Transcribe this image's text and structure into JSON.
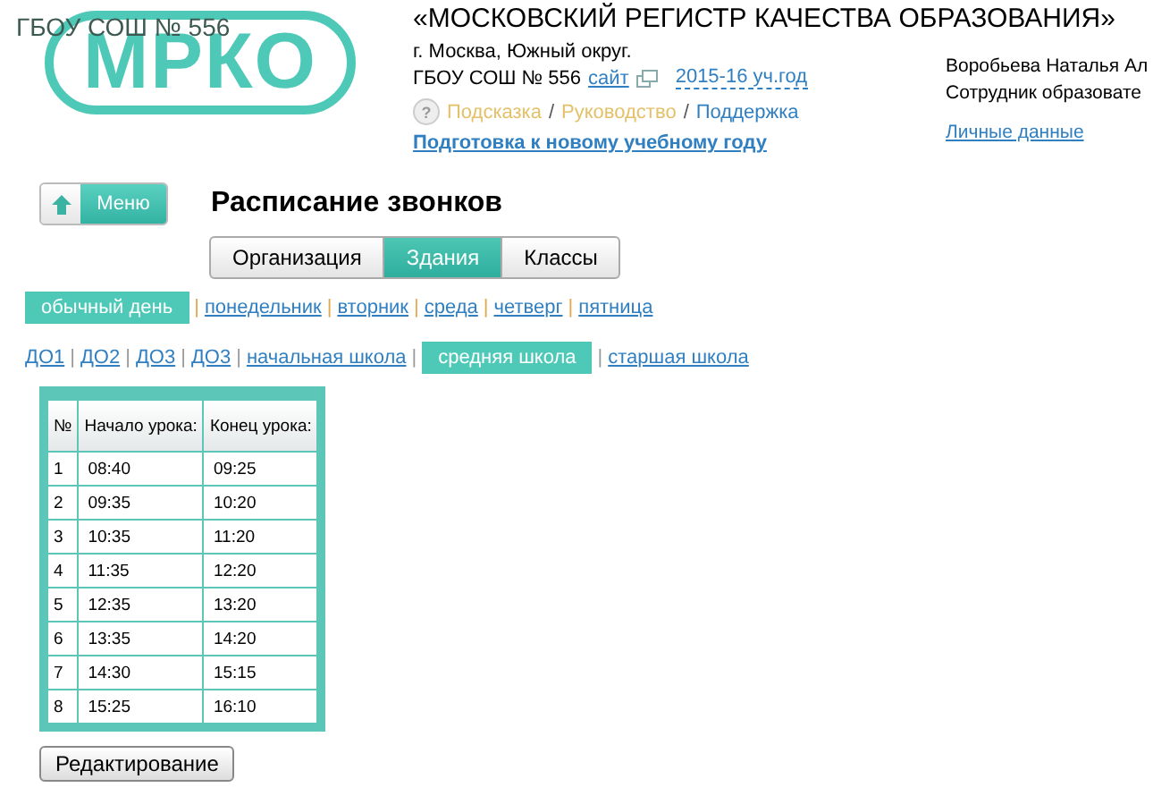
{
  "school_label": "ГБОУ СОШ № 556",
  "logo": {
    "text": "МРКО"
  },
  "header": {
    "title": "«МОСКОВСКИЙ РЕГИСТР КАЧЕСТВА ОБРАЗОВАНИЯ»",
    "district": "г. Москва, Южный округ.",
    "school": "ГБОУ СОШ № 556",
    "site_link": "сайт",
    "year": "2015-16 уч.год",
    "help_icon": "?",
    "help_separator": "/",
    "help_links": [
      {
        "label": "Подсказка",
        "kind": "tip"
      },
      {
        "label": "Руководство",
        "kind": "tip"
      },
      {
        "label": "Поддержка",
        "kind": "link"
      }
    ],
    "prep_link": "Подготовка к новому учебному году"
  },
  "user": {
    "name": "Воробьева Наталья Ал",
    "role": "Сотрудник образовате",
    "profile_link": "Личные данные"
  },
  "menu_button": "Меню",
  "page_title": "Расписание звонков",
  "tabs": [
    {
      "label": "Организация",
      "selected": false
    },
    {
      "label": "Здания",
      "selected": true
    },
    {
      "label": "Классы",
      "selected": false
    }
  ],
  "link_separator": "|",
  "days": [
    {
      "label": "обычный день",
      "selected": true
    },
    {
      "label": "понедельник",
      "selected": false
    },
    {
      "label": "вторник",
      "selected": false
    },
    {
      "label": "среда",
      "selected": false
    },
    {
      "label": "четверг",
      "selected": false
    },
    {
      "label": "пятница",
      "selected": false
    }
  ],
  "buildings": [
    {
      "label": "ДО1",
      "selected": false
    },
    {
      "label": "ДО2",
      "selected": false
    },
    {
      "label": "ДО3",
      "selected": false
    },
    {
      "label": "ДО3",
      "selected": false
    },
    {
      "label": "начальная школа",
      "selected": false
    },
    {
      "label": "средняя школа",
      "selected": true
    },
    {
      "label": "старшая школа",
      "selected": false
    }
  ],
  "table": {
    "columns": [
      "№",
      "Начало урока:",
      "Конец урока:"
    ],
    "rows": [
      [
        "1",
        "08:40",
        "09:25"
      ],
      [
        "2",
        "09:35",
        "10:20"
      ],
      [
        "3",
        "10:35",
        "11:20"
      ],
      [
        "4",
        "11:35",
        "12:20"
      ],
      [
        "5",
        "12:35",
        "13:20"
      ],
      [
        "6",
        "13:35",
        "14:20"
      ],
      [
        "7",
        "14:30",
        "15:15"
      ],
      [
        "8",
        "15:25",
        "16:10"
      ]
    ]
  },
  "edit_button": "Редактирование"
}
